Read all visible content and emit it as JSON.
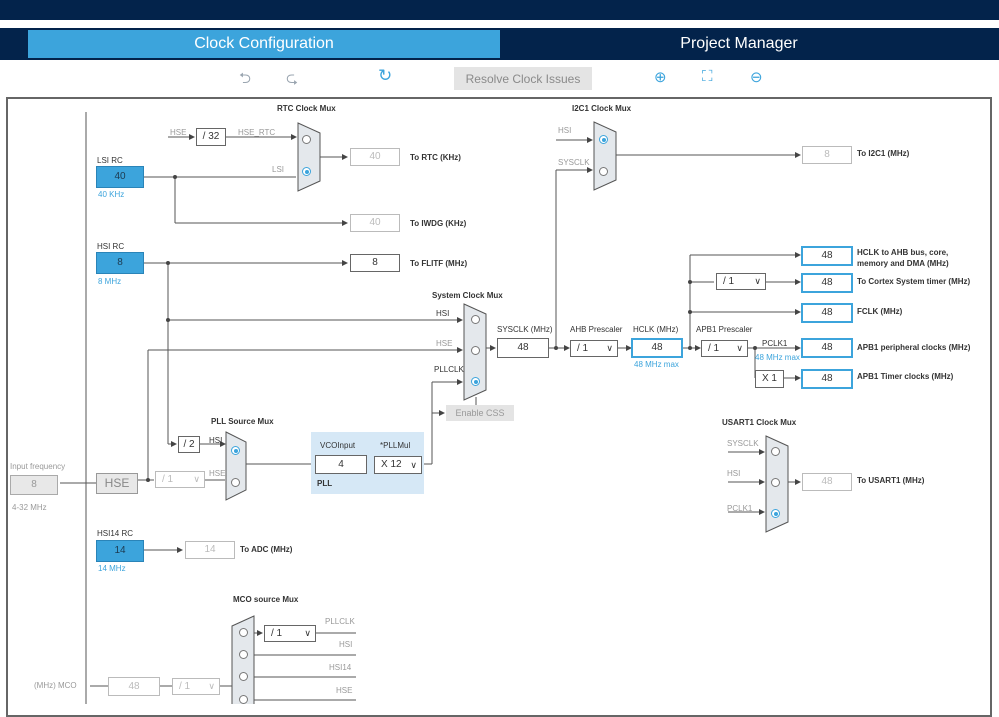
{
  "tabs": [
    {
      "label": "Clock Configuration",
      "active": true
    },
    {
      "label": "Project Manager",
      "active": false
    }
  ],
  "toolbar": {
    "undo_icon": "undo-icon",
    "redo_icon": "redo-icon",
    "refresh_icon": "refresh-icon",
    "resolve_label": "Resolve Clock Issues",
    "zoom_in_icon": "zoom-in-icon",
    "fit_icon": "fit-screen-icon",
    "zoom_out_icon": "zoom-out-icon"
  },
  "colors": {
    "nav": "#03234b",
    "accent": "#3ca4dc"
  },
  "diagram": {
    "rtc_mux_title": "RTC Clock Mux",
    "i2c1_mux_title": "I2C1 Clock Mux",
    "sysclk_mux_title": "System Clock Mux",
    "pll_src_mux_title": "PLL Source Mux",
    "usart1_mux_title": "USART1 Clock Mux",
    "mco_mux_title": "MCO source Mux",
    "hse_label": "HSE",
    "hse_rtc_label": "HSE_RTC",
    "lsi_label": "LSI",
    "hsi_label": "HSI",
    "sysclk_label": "SYSCLK",
    "pllclk_label": "PLLCLK",
    "pclk1_label": "PCLK1",
    "hsi14_label": "HSI14",
    "div32": "/ 32",
    "lsi_rc": {
      "title": "LSI RC",
      "value": "40",
      "unit": "40 KHz"
    },
    "hsi_rc": {
      "title": "HSI RC",
      "value": "8",
      "unit": "8 MHz"
    },
    "hsi14_rc": {
      "title": "HSI14 RC",
      "value": "14",
      "unit": "14 MHz"
    },
    "rtc_out": {
      "value": "40",
      "label": "To RTC (KHz)"
    },
    "iwdg_out": {
      "value": "40",
      "label": "To IWDG (KHz)"
    },
    "flitf_out": {
      "value": "8",
      "label": "To FLITF (MHz)"
    },
    "i2c1_out": {
      "value": "8",
      "label": "To I2C1 (MHz)"
    },
    "adc_out": {
      "value": "14",
      "label": "To ADC (MHz)"
    },
    "usart1_out": {
      "value": "48",
      "label": "To USART1 (MHz)"
    },
    "sysclk_title": "SYSCLK (MHz)",
    "sysclk_value": "48",
    "ahb_title": "AHB Prescaler",
    "ahb_value": "/ 1",
    "hclk_title": "HCLK (MHz)",
    "hclk_value": "48",
    "hclk_max": "48 MHz max",
    "apb1_title": "APB1 Prescaler",
    "apb1_value": "/ 1",
    "pclk1_max": "48 MHz max",
    "x1_label": "X 1",
    "cortex_div": "/ 1",
    "outputs": [
      {
        "value": "48",
        "label": "HCLK to AHB bus, core,",
        "label2": "memory and DMA (MHz)"
      },
      {
        "value": "48",
        "label": "To Cortex System timer (MHz)"
      },
      {
        "value": "48",
        "label": "FCLK (MHz)"
      },
      {
        "value": "48",
        "label": "APB1 peripheral clocks (MHz)"
      },
      {
        "value": "48",
        "label": "APB1 Timer clocks (MHz)"
      }
    ],
    "enable_css": "Enable CSS",
    "pll_div2": "/ 2",
    "hse_prediv": "/ 1",
    "vco_title": "VCOInput",
    "vco_value": "4",
    "pllmul_title": "*PLLMul",
    "pllmul_value": "X 12",
    "pll_label": "PLL",
    "input_freq_title": "Input frequency",
    "input_freq_value": "8",
    "input_freq_range": "4-32 MHz",
    "hse_source": "HSE",
    "mco_label": "(MHz) MCO",
    "mco_value": "48",
    "mco_div": "/ 1",
    "mco_pll_div": "/ 1"
  }
}
